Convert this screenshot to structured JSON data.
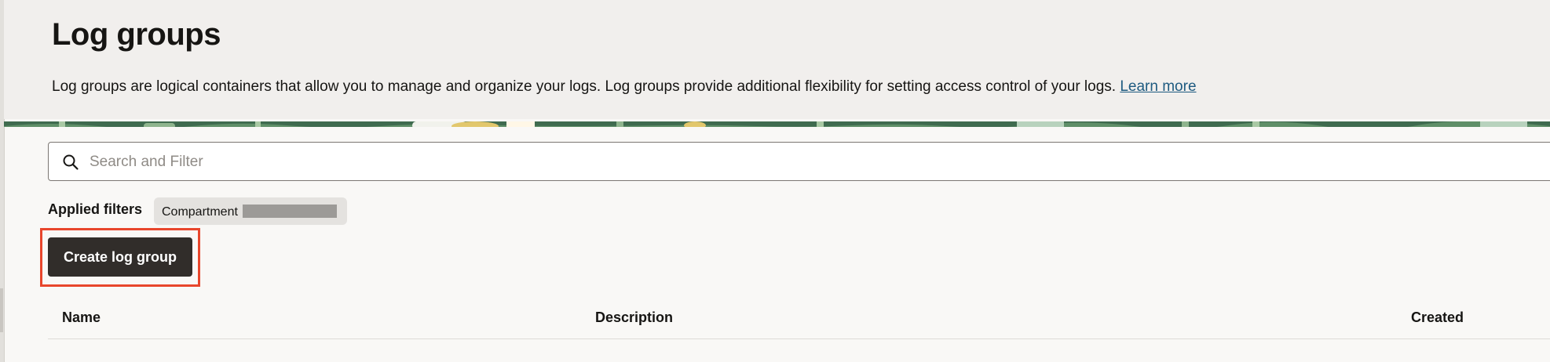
{
  "header": {
    "title": "Log groups",
    "description": "Log groups are logical containers that allow you to manage and organize your logs. Log groups provide additional flexibility for setting access control of your logs.",
    "learn_more": "Learn more"
  },
  "search": {
    "placeholder": "Search and Filter",
    "value": ""
  },
  "filters": {
    "label": "Applied filters",
    "chips": [
      {
        "label": "Compartment"
      }
    ]
  },
  "actions": {
    "create_label": "Create log group"
  },
  "table": {
    "columns": [
      "Name",
      "Description",
      "Created"
    ]
  },
  "colors": {
    "primary_button": "#312d2a",
    "link": "#1d5a80",
    "highlight": "#e8462c",
    "header_bg": "#f1efed"
  },
  "icons": [
    "search-icon"
  ]
}
